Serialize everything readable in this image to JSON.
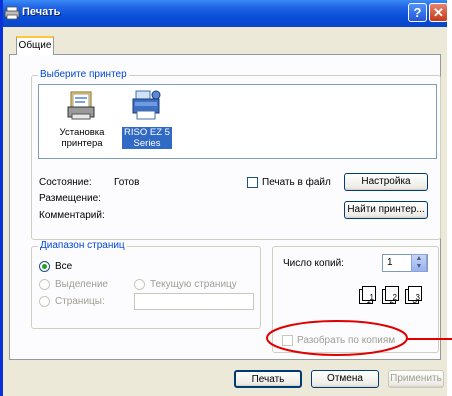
{
  "window": {
    "title": "Печать",
    "help": "?",
    "close": "✕"
  },
  "tab": {
    "label": "Общие"
  },
  "printer_group": {
    "legend": "Выберите принтер",
    "items": [
      {
        "label_line1": "Установка",
        "label_line2": "принтера",
        "icon": "add-printer-icon",
        "selected": false
      },
      {
        "label_line1": "RISO EZ 5",
        "label_line2": "Series",
        "icon": "printer-icon",
        "selected": true
      }
    ]
  },
  "status": {
    "state_label": "Состояние:",
    "state_value": "Готов",
    "location_label": "Размещение:",
    "comment_label": "Комментарий:",
    "print_to_file": "Печать в файл",
    "settings_button": "Настройка",
    "find_printer_button": "Найти принтер..."
  },
  "range_group": {
    "legend": "Диапазон страниц",
    "all": "Все",
    "selection": "Выделение",
    "current_page": "Текущую страницу",
    "pages": "Страницы:"
  },
  "copies": {
    "label": "Число копий:",
    "value": "1",
    "collate": "Разобрать по копиям",
    "page_numbers": [
      "1",
      "1",
      "2",
      "2",
      "3",
      "3"
    ]
  },
  "buttons": {
    "print": "Печать",
    "cancel": "Отмена",
    "apply": "Применить"
  },
  "colors": {
    "title_bar": "#0a4fd9",
    "annotation": "#e00000",
    "selection": "#316ac5",
    "disabled_text": "#a09e94"
  }
}
